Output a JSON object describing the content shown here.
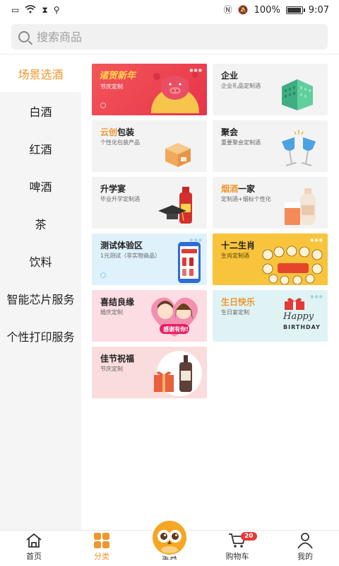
{
  "status": {
    "battery_pct_text": "100%",
    "time": "9:07",
    "battery_level": 1.0
  },
  "search": {
    "placeholder": "搜索商品"
  },
  "sidebar": {
    "items": [
      {
        "label": "场景选酒",
        "active": true
      },
      {
        "label": "白酒"
      },
      {
        "label": "红酒"
      },
      {
        "label": "啤酒"
      },
      {
        "label": "茶"
      },
      {
        "label": "饮料"
      },
      {
        "label": "智能芯片服务"
      },
      {
        "label": "个性打印服务"
      }
    ]
  },
  "cards": [
    {
      "title": "",
      "subtitle": "节庆定制",
      "banner_text": "诸贺新年"
    },
    {
      "title": "企业",
      "subtitle": "企业礼品定制酒"
    },
    {
      "title_accent": "云创",
      "title_rest": "包装",
      "subtitle": "个性化包装产品"
    },
    {
      "title": "聚会",
      "subtitle": "重要聚会定制酒"
    },
    {
      "title": "升学宴",
      "subtitle": "毕业升学定制酒"
    },
    {
      "title_accent": "烟酒",
      "title_rest": "一家",
      "subtitle": "定制酒+烟标个性化"
    },
    {
      "title": "测试体验区",
      "subtitle": "1元测试（非实物商品）"
    },
    {
      "title": "十二生肖",
      "subtitle": "生肖定制酒"
    },
    {
      "title": "喜结良缘",
      "subtitle": "婚庆定制",
      "bubble": "感谢有你!"
    },
    {
      "title": "生日快乐",
      "subtitle": "生日宴定制",
      "art_line1": "Happy",
      "art_line2": "BIRTHDAY"
    },
    {
      "title": "佳节祝福",
      "subtitle": "节庆定制"
    }
  ],
  "nav": {
    "items": [
      {
        "label": "首页"
      },
      {
        "label": "分类",
        "active": true
      },
      {
        "label": "鉴真"
      },
      {
        "label": "购物车",
        "badge": "20"
      },
      {
        "label": "我的"
      }
    ]
  },
  "colors": {
    "accent": "#f0962e",
    "badge": "#e53935",
    "sidebar_bg": "#f5f5f5"
  }
}
